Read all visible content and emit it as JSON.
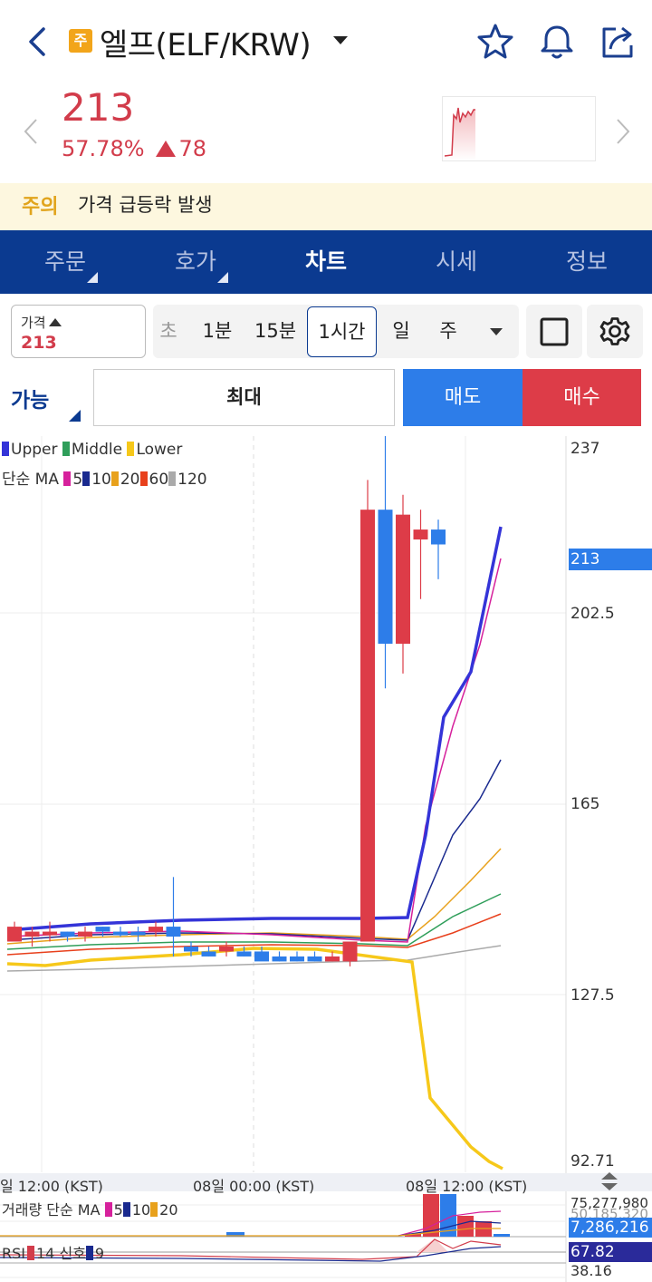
{
  "header": {
    "badge": "주",
    "coin_name": "엘프(ELF/KRW)"
  },
  "price": {
    "current": "213",
    "change_percent": "57.78%",
    "change_amount": "78",
    "color_up": "#d23c4b"
  },
  "warning": {
    "title": "주의",
    "message": "가격 급등락 발생"
  },
  "tabs": [
    {
      "label": "주문"
    },
    {
      "label": "호가"
    },
    {
      "label": "차트"
    },
    {
      "label": "시세"
    },
    {
      "label": "정보"
    }
  ],
  "toolbar": {
    "price_label": "가격",
    "price_value": "213",
    "timeframes": [
      "초",
      "1분",
      "15분",
      "1시간",
      "일",
      "주"
    ],
    "selected_timeframe": "1시간"
  },
  "order": {
    "available_label": "가능",
    "max_label": "최대",
    "sell_label": "매도",
    "buy_label": "매수"
  },
  "chart": {
    "legend_bb": [
      "Upper",
      "Middle",
      "Lower"
    ],
    "legend_ma_title": "단순 MA",
    "legend_ma": [
      "5",
      "10",
      "20",
      "60",
      "120"
    ],
    "axis": [
      "237",
      "213",
      "202.5",
      "165",
      "127.5",
      "92.71"
    ],
    "time_labels": [
      "일 12:00 (KST)",
      "08일 00:00 (KST)",
      "08일 12:00 (KST)"
    ],
    "volume_legend_title": "거래량 단순 MA",
    "volume_legend": [
      "5",
      "10",
      "20"
    ],
    "volume_axis": [
      "75,277,980",
      "50,185,320",
      "7,286,216"
    ],
    "rsi_label": "RSI",
    "rsi_period": "14",
    "rsi_signal_label": "신호",
    "rsi_signal": "9",
    "rsi_axis": [
      "67.82",
      "38.16"
    ]
  },
  "chart_data": {
    "type": "candlestick",
    "ylim": [
      92.71,
      237
    ],
    "candles": [
      {
        "o": 140,
        "h": 141,
        "l": 137,
        "c": 137,
        "up": true
      },
      {
        "o": 138,
        "h": 140,
        "l": 136,
        "c": 139,
        "up": true
      },
      {
        "o": 139,
        "h": 141,
        "l": 137,
        "c": 139,
        "up": true
      },
      {
        "o": 138,
        "h": 139,
        "l": 137,
        "c": 139,
        "up": false
      },
      {
        "o": 138,
        "h": 140,
        "l": 137,
        "c": 139,
        "up": true
      },
      {
        "o": 139,
        "h": 140,
        "l": 138,
        "c": 140,
        "up": false
      },
      {
        "o": 139,
        "h": 140,
        "l": 138,
        "c": 139,
        "up": false
      },
      {
        "o": 139,
        "h": 140,
        "l": 137,
        "c": 139,
        "up": false
      },
      {
        "o": 140,
        "h": 141,
        "l": 138,
        "c": 139,
        "up": true
      },
      {
        "o": 140,
        "h": 150,
        "l": 134,
        "c": 138,
        "up": false
      },
      {
        "o": 136,
        "h": 137,
        "l": 134,
        "c": 135,
        "up": false
      },
      {
        "o": 135,
        "h": 136,
        "l": 134,
        "c": 134,
        "up": false
      },
      {
        "o": 136,
        "h": 137,
        "l": 134,
        "c": 135,
        "up": true
      },
      {
        "o": 135,
        "h": 136,
        "l": 134,
        "c": 134,
        "up": false
      },
      {
        "o": 135,
        "h": 136,
        "l": 134,
        "c": 133,
        "up": false
      },
      {
        "o": 134,
        "h": 135,
        "l": 133,
        "c": 133,
        "up": false
      },
      {
        "o": 134,
        "h": 135,
        "l": 133,
        "c": 133,
        "up": false
      },
      {
        "o": 134,
        "h": 135,
        "l": 133,
        "c": 133,
        "up": false
      },
      {
        "o": 134,
        "h": 135,
        "l": 133,
        "c": 133,
        "up": true
      },
      {
        "o": 133,
        "h": 137,
        "l": 132,
        "c": 137,
        "up": true
      },
      {
        "o": 137,
        "h": 230,
        "l": 137,
        "c": 224,
        "up": true
      },
      {
        "o": 224,
        "h": 240,
        "l": 188,
        "c": 197,
        "up": false
      },
      {
        "o": 197,
        "h": 227,
        "l": 191,
        "c": 223,
        "up": true
      },
      {
        "o": 218,
        "h": 224,
        "l": 206,
        "c": 220,
        "up": true
      },
      {
        "o": 220,
        "h": 222,
        "l": 210,
        "c": 217,
        "up": false
      }
    ]
  }
}
